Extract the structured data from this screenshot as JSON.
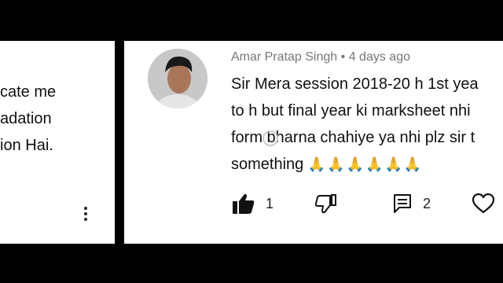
{
  "left_card": {
    "lines": [
      "cate me",
      "adation",
      "ion Hai."
    ]
  },
  "comment": {
    "author": "Amar Pratap Singh",
    "separator": "•",
    "time": "4 days ago",
    "lines": [
      "Sir Mera session 2018-20 h 1st yea",
      "to h but final year ki marksheet nhi",
      "form bharna chahiye ya nhi plz sir t",
      "something"
    ],
    "emoji": "🙏🙏🙏🙏🙏🙏",
    "likes": "1",
    "replies": "2"
  },
  "icons": {
    "like": "thumbs-up-icon",
    "dislike": "thumbs-down-icon",
    "reply": "reply-comment-icon",
    "heart": "heart-icon",
    "more": "more-vertical-icon"
  },
  "colors": {
    "text": "#111111",
    "meta": "#777777",
    "background": "#ffffff",
    "letterbox": "#000000"
  }
}
